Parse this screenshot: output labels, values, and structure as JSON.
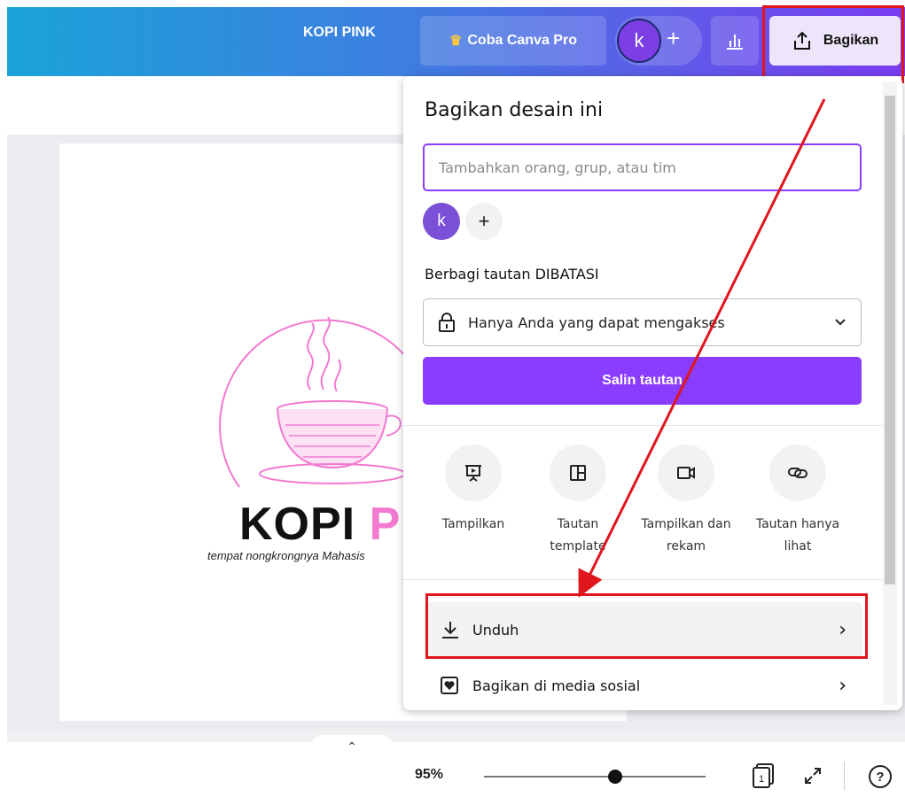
{
  "topbar": {
    "doc_title": "KOPI PINK",
    "pro_button": "Coba Canva Pro",
    "avatar_letter": "k",
    "share_button": "Bagikan"
  },
  "canvas": {
    "logo_title_dark": "KOPI ",
    "logo_title_pink": "PINK",
    "logo_tagline": "tempat nongkrongnya Mahasis"
  },
  "share_panel": {
    "title": "Bagikan desain ini",
    "people_placeholder": "Tambahkan orang, grup, atau tim",
    "avatar_letter": "k",
    "link_label": "Berbagi tautan DIBATASI",
    "access_value": "Hanya Anda yang dapat mengakses",
    "copy_link": "Salin tautan",
    "options": [
      {
        "line1": "Tampilkan",
        "line2": "",
        "icon": "present-icon"
      },
      {
        "line1": "Tautan",
        "line2": "template",
        "icon": "template-icon"
      },
      {
        "line1": "Tampilkan dan",
        "line2": "rekam",
        "icon": "record-icon"
      },
      {
        "line1": "Tautan hanya",
        "line2": "lihat",
        "icon": "link-icon"
      }
    ],
    "download": "Unduh",
    "social": "Bagikan di media sosial"
  },
  "bottombar": {
    "zoom": "95%",
    "zoom_fraction": 0.59,
    "page_count": "1",
    "help": "?"
  },
  "colors": {
    "accent": "#8b3dff",
    "highlight": "#e0161d",
    "logo_pink": "#f27ad1"
  }
}
